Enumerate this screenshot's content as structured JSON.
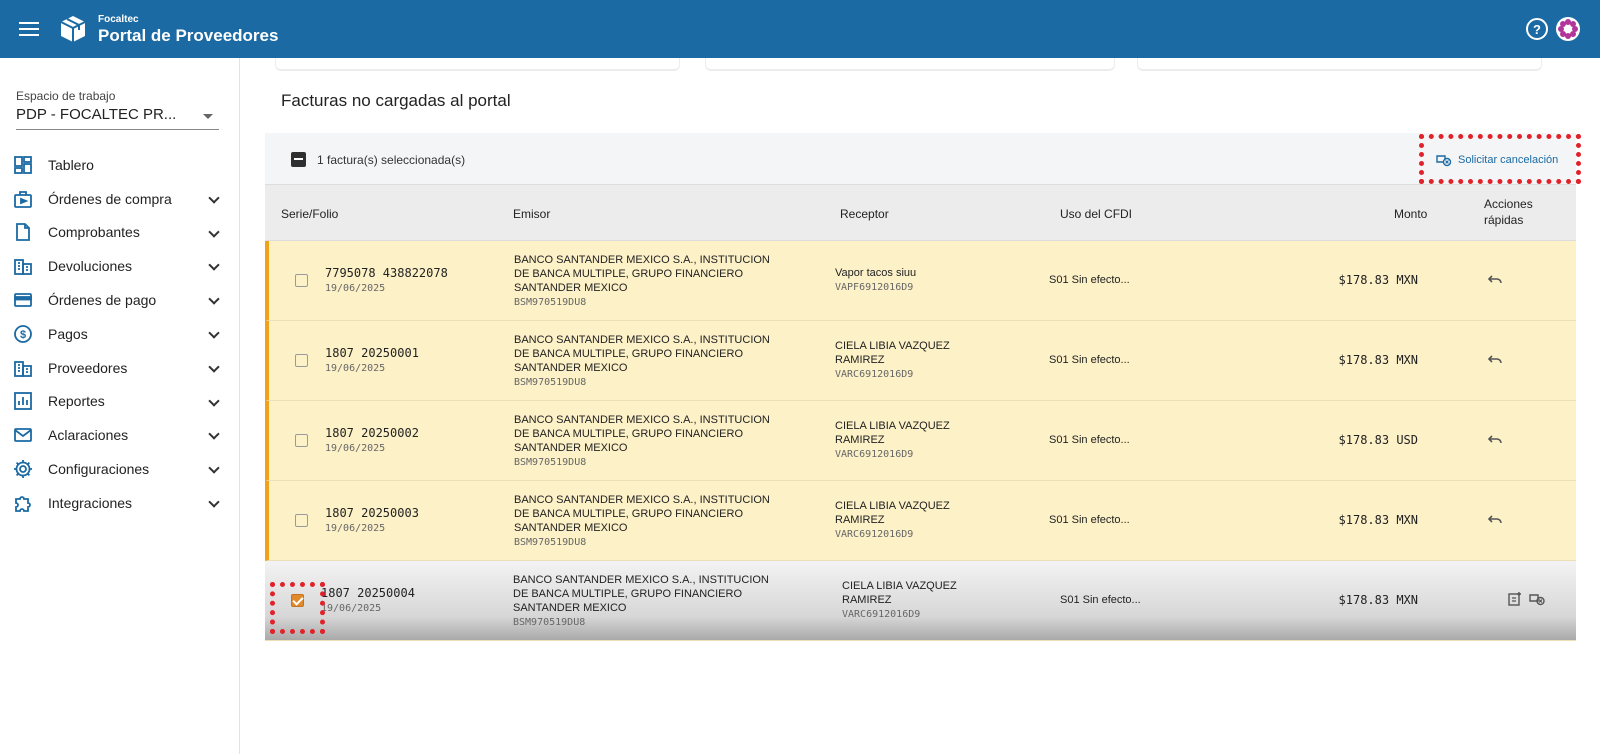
{
  "header": {
    "brand_small": "Focaltec",
    "brand_title": "Portal de Proveedores"
  },
  "sidebar": {
    "workspace_label": "Espacio de trabajo",
    "workspace_value": "PDP - FOCALTEC PR...",
    "items": [
      {
        "label": "Tablero",
        "icon": "dashboard-icon",
        "expandable": false
      },
      {
        "label": "Órdenes de compra",
        "icon": "purchase-order-icon",
        "expandable": true
      },
      {
        "label": "Comprobantes",
        "icon": "document-icon",
        "expandable": true
      },
      {
        "label": "Devoluciones",
        "icon": "buildings-icon",
        "expandable": true
      },
      {
        "label": "Órdenes de pago",
        "icon": "credit-card-icon",
        "expandable": true
      },
      {
        "label": "Pagos",
        "icon": "dollar-icon",
        "expandable": true
      },
      {
        "label": "Proveedores",
        "icon": "buildings-icon",
        "expandable": true
      },
      {
        "label": "Reportes",
        "icon": "chart-icon",
        "expandable": true
      },
      {
        "label": "Aclaraciones",
        "icon": "mail-icon",
        "expandable": true
      },
      {
        "label": "Configuraciones",
        "icon": "gear-icon",
        "expandable": true
      },
      {
        "label": "Integraciones",
        "icon": "puzzle-icon",
        "expandable": true
      }
    ]
  },
  "panel": {
    "title": "Facturas no cargadas al portal",
    "selection_text": "1 factura(s) seleccionada(s)",
    "cancel_action": "Solicitar cancelación"
  },
  "table": {
    "columns": {
      "serie": "Serie/Folio",
      "emisor": "Emisor",
      "receptor": "Receptor",
      "uso": "Uso del CFDI",
      "monto": "Monto",
      "acciones_1": "Acciones",
      "acciones_2": "rápidas"
    },
    "rows": [
      {
        "folio": "7795078 438822078",
        "date": "19/06/2025",
        "emisor_1": "BANCO SANTANDER MEXICO S.A., INSTITUCION",
        "emisor_2": "DE BANCA MULTIPLE, GRUPO FINANCIERO",
        "emisor_3": "SANTANDER MEXICO",
        "emisor_rfc": "BSM970519DU8",
        "receptor_1": "Vapor tacos siuu",
        "receptor_2": "",
        "receptor_rfc": "VAPF6912016D9",
        "uso": "S01 Sin efecto...",
        "monto": "$178.83 MXN",
        "checked": false
      },
      {
        "folio": "1807 20250001",
        "date": "19/06/2025",
        "emisor_1": "BANCO SANTANDER MEXICO S.A., INSTITUCION",
        "emisor_2": "DE BANCA MULTIPLE, GRUPO FINANCIERO",
        "emisor_3": "SANTANDER MEXICO",
        "emisor_rfc": "BSM970519DU8",
        "receptor_1": "CIELA LIBIA VAZQUEZ",
        "receptor_2": "RAMIREZ",
        "receptor_rfc": "VARC6912016D9",
        "uso": "S01 Sin efecto...",
        "monto": "$178.83 MXN",
        "checked": false
      },
      {
        "folio": "1807 20250002",
        "date": "19/06/2025",
        "emisor_1": "BANCO SANTANDER MEXICO S.A., INSTITUCION",
        "emisor_2": "DE BANCA MULTIPLE, GRUPO FINANCIERO",
        "emisor_3": "SANTANDER MEXICO",
        "emisor_rfc": "BSM970519DU8",
        "receptor_1": "CIELA LIBIA VAZQUEZ",
        "receptor_2": "RAMIREZ",
        "receptor_rfc": "VARC6912016D9",
        "uso": "S01 Sin efecto...",
        "monto": "$178.83 USD",
        "checked": false
      },
      {
        "folio": "1807 20250003",
        "date": "19/06/2025",
        "emisor_1": "BANCO SANTANDER MEXICO S.A., INSTITUCION",
        "emisor_2": "DE BANCA MULTIPLE, GRUPO FINANCIERO",
        "emisor_3": "SANTANDER MEXICO",
        "emisor_rfc": "BSM970519DU8",
        "receptor_1": "CIELA LIBIA VAZQUEZ",
        "receptor_2": "RAMIREZ",
        "receptor_rfc": "VARC6912016D9",
        "uso": "S01 Sin efecto...",
        "monto": "$178.83 MXN",
        "checked": false
      },
      {
        "folio": "1807 20250004",
        "date": "19/06/2025",
        "emisor_1": "BANCO SANTANDER MEXICO S.A., INSTITUCION",
        "emisor_2": "DE BANCA MULTIPLE, GRUPO FINANCIERO",
        "emisor_3": "SANTANDER MEXICO",
        "emisor_rfc": "BSM970519DU8",
        "receptor_1": "CIELA LIBIA VAZQUEZ",
        "receptor_2": "RAMIREZ",
        "receptor_rfc": "VARC6912016D9",
        "uso": "S01 Sin efecto...",
        "monto": "$178.83 MXN",
        "checked": true
      }
    ]
  },
  "colors": {
    "primary": "#1b6aa3",
    "row_highlight": "#fdf1c8",
    "row_accent": "#f0a21b",
    "annotation": "#e0222a"
  }
}
